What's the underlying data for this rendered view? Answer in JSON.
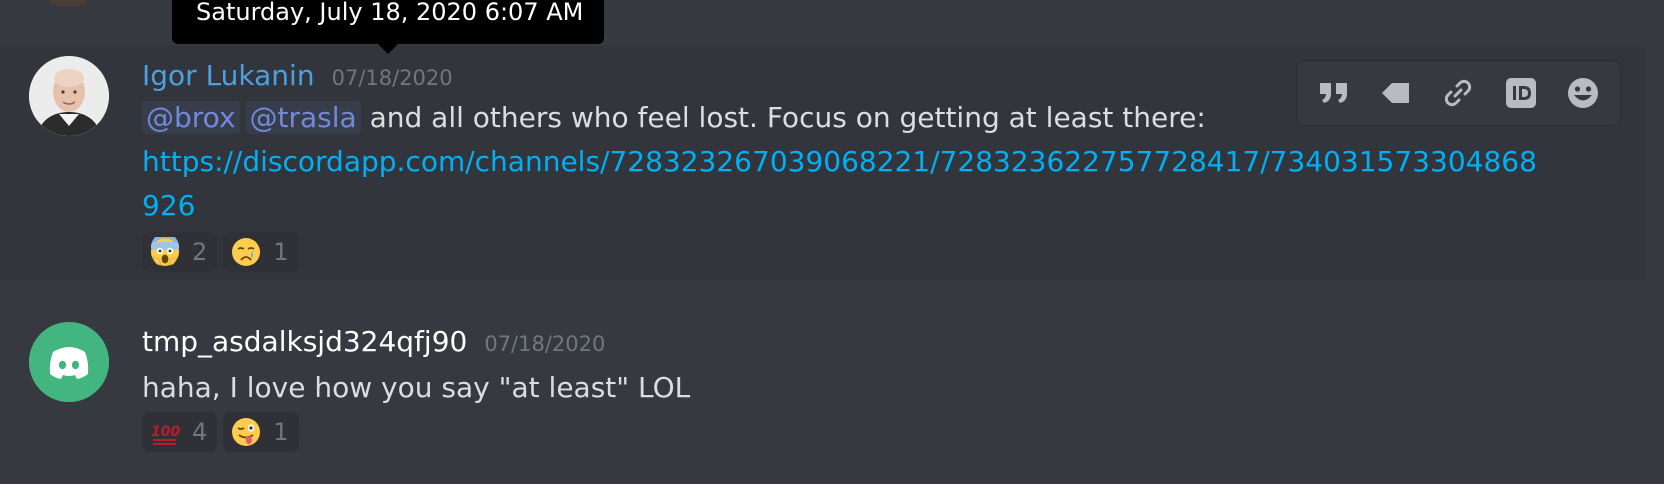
{
  "tooltip": {
    "text": "Saturday, July 18, 2020 6:07 AM"
  },
  "toolbar": {
    "items": [
      {
        "icon": "quote-icon"
      },
      {
        "icon": "pin-icon"
      },
      {
        "icon": "link-icon"
      },
      {
        "icon": "id-icon"
      },
      {
        "icon": "add-reaction-icon"
      }
    ]
  },
  "messages": [
    {
      "username": "Igor Lukanin",
      "username_color": "#4ca0e0",
      "timestamp": "07/18/2020",
      "mentions": [
        "@brox",
        "@trasla"
      ],
      "text": " and all others who feel lost. Focus on getting at least there:",
      "link": "https://discordapp.com/channels/728323267039068221/728323622757728417/734031573304868926",
      "reactions": [
        {
          "emoji": "scream-emoji",
          "count": "2"
        },
        {
          "emoji": "cry-emoji",
          "count": "1"
        }
      ]
    },
    {
      "username": "tmp_asdalksjd324qfj90",
      "username_color": "#ffffff",
      "timestamp": "07/18/2020",
      "text": "haha, I love how you say \"at least\" LOL",
      "reactions": [
        {
          "emoji": "100-emoji",
          "count": "4"
        },
        {
          "emoji": "winking-tongue-emoji",
          "count": "1"
        }
      ]
    }
  ]
}
